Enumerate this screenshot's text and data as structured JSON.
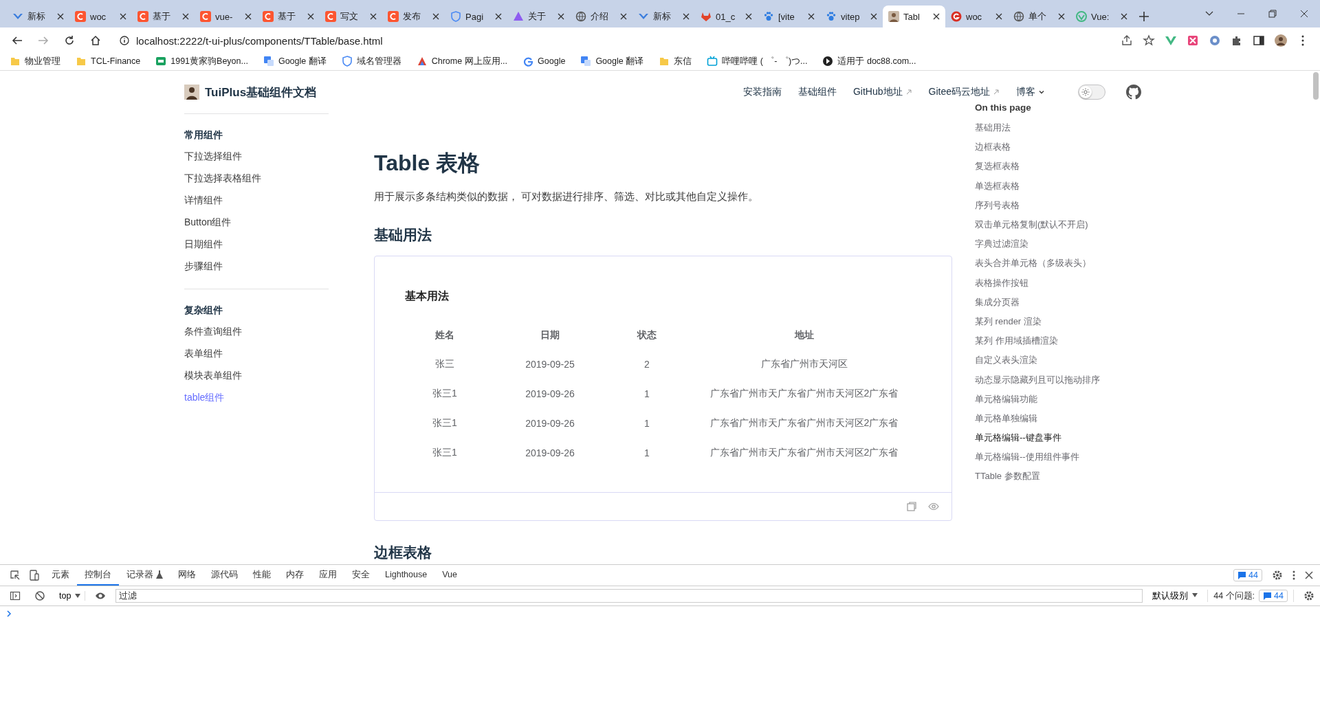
{
  "browser": {
    "tabs": [
      {
        "label": "新标",
        "kind": "bird",
        "selected": false
      },
      {
        "label": "woc",
        "kind": "csdn",
        "selected": false
      },
      {
        "label": "基于",
        "kind": "csdn",
        "selected": false
      },
      {
        "label": "vue-",
        "kind": "csdn",
        "selected": false
      },
      {
        "label": "基于",
        "kind": "csdn",
        "selected": false
      },
      {
        "label": "写文",
        "kind": "csdn",
        "selected": false
      },
      {
        "label": "发布",
        "kind": "csdn",
        "selected": false
      },
      {
        "label": "Pagi",
        "kind": "shield",
        "selected": false
      },
      {
        "label": "关于",
        "kind": "prism",
        "selected": false
      },
      {
        "label": "介绍",
        "kind": "globe",
        "selected": false
      },
      {
        "label": "新标",
        "kind": "bird",
        "selected": false
      },
      {
        "label": "01_c",
        "kind": "gitlab",
        "selected": false
      },
      {
        "label": "[vite",
        "kind": "paw",
        "selected": false
      },
      {
        "label": "vitep",
        "kind": "paw",
        "selected": false
      },
      {
        "label": "Tabl",
        "kind": "avatar",
        "selected": true
      },
      {
        "label": "woc",
        "kind": "google",
        "selected": false
      },
      {
        "label": "单个",
        "kind": "globe",
        "selected": false
      },
      {
        "label": "Vue:",
        "kind": "vue",
        "selected": false
      }
    ],
    "address": "localhost:2222/t-ui-plus/components/TTable/base.html",
    "bookmarks": [
      {
        "label": "物业管理",
        "kind": "folder"
      },
      {
        "label": "TCL-Finance",
        "kind": "folder"
      },
      {
        "label": "1991黄家驹Beyon...",
        "kind": "green"
      },
      {
        "label": "Google 翻译",
        "kind": "translate"
      },
      {
        "label": "域名管理器",
        "kind": "shield"
      },
      {
        "label": "Chrome 网上应用...",
        "kind": "store"
      },
      {
        "label": "Google",
        "kind": "google"
      },
      {
        "label": "Google 翻译",
        "kind": "translate"
      },
      {
        "label": "东信",
        "kind": "folder"
      },
      {
        "label": "哔哩哔哩 ( ゜- ゜)つ...",
        "kind": "tv"
      },
      {
        "label": "适用于 doc88.com...",
        "kind": "dark"
      }
    ]
  },
  "site": {
    "title": "TuiPlus基础组件文档",
    "nav": [
      {
        "label": "安装指南",
        "kind": "link"
      },
      {
        "label": "基础组件",
        "kind": "link"
      },
      {
        "label": "GitHub地址",
        "kind": "external"
      },
      {
        "label": "Gitee码云地址",
        "kind": "external"
      },
      {
        "label": "博客",
        "kind": "menu"
      }
    ],
    "dark_mode": false
  },
  "sidebar": [
    {
      "heading": "常用组件",
      "items": [
        {
          "label": "下拉选择组件",
          "selected": false
        },
        {
          "label": "下拉选择表格组件",
          "selected": false
        },
        {
          "label": "详情组件",
          "selected": false
        },
        {
          "label": "Button组件",
          "selected": false
        },
        {
          "label": "日期组件",
          "selected": false
        },
        {
          "label": "步骤组件",
          "selected": false
        }
      ]
    },
    {
      "heading": "复杂组件",
      "items": [
        {
          "label": "条件查询组件",
          "selected": false
        },
        {
          "label": "表单组件",
          "selected": false
        },
        {
          "label": "模块表单组件",
          "selected": false
        },
        {
          "label": "table组件",
          "selected": true
        }
      ]
    }
  ],
  "content": {
    "title": "Table 表格",
    "description": "用于展示多条结构类似的数据， 可对数据进行排序、筛选、对比或其他自定义操作。",
    "section": "基础用法",
    "demo": {
      "title": "基本用法",
      "columns": [
        "姓名",
        "日期",
        "状态",
        "地址"
      ],
      "rows": [
        [
          "张三",
          "2019-09-25",
          "2",
          "广东省广州市天河区"
        ],
        [
          "张三1",
          "2019-09-26",
          "1",
          "广东省广州市天广东省广州市天河区2广东省"
        ],
        [
          "张三1",
          "2019-09-26",
          "1",
          "广东省广州市天广东省广州市天河区2广东省"
        ],
        [
          "张三1",
          "2019-09-26",
          "1",
          "广东省广州市天广东省广州市天河区2广东省"
        ]
      ]
    },
    "next_section": "边框表格"
  },
  "toc": {
    "title": "On this page",
    "items": [
      {
        "label": "基础用法",
        "hovered": false
      },
      {
        "label": "边框表格",
        "hovered": false
      },
      {
        "label": "复选框表格",
        "hovered": false
      },
      {
        "label": "单选框表格",
        "hovered": false
      },
      {
        "label": "序列号表格",
        "hovered": false
      },
      {
        "label": "双击单元格复制(默认不开启)",
        "hovered": false
      },
      {
        "label": "字典过滤渲染",
        "hovered": false
      },
      {
        "label": "表头合并单元格（多级表头）",
        "hovered": false
      },
      {
        "label": "表格操作按钮",
        "hovered": false
      },
      {
        "label": "集成分页器",
        "hovered": false
      },
      {
        "label": "某列 render 渲染",
        "hovered": false
      },
      {
        "label": "某列 作用域插槽渲染",
        "hovered": false
      },
      {
        "label": "自定义表头渲染",
        "hovered": false
      },
      {
        "label": "动态显示隐藏列且可以拖动排序",
        "hovered": false
      },
      {
        "label": "单元格编辑功能",
        "hovered": false
      },
      {
        "label": "单元格单独编辑",
        "hovered": false
      },
      {
        "label": "单元格编辑--键盘事件",
        "hovered": true
      },
      {
        "label": "单元格编辑--使用组件事件",
        "hovered": false
      },
      {
        "label": "TTable 参数配置",
        "hovered": false
      }
    ]
  },
  "devtools": {
    "tabs": [
      {
        "label": "元素",
        "selected": false
      },
      {
        "label": "控制台",
        "selected": true
      },
      {
        "label": "记录器",
        "selected": false
      },
      {
        "label": "网络",
        "selected": false
      },
      {
        "label": "源代码",
        "selected": false
      },
      {
        "label": "性能",
        "selected": false
      },
      {
        "label": "内存",
        "selected": false
      },
      {
        "label": "应用",
        "selected": false
      },
      {
        "label": "安全",
        "selected": false
      },
      {
        "label": "Lighthouse",
        "selected": false
      },
      {
        "label": "Vue",
        "selected": false
      }
    ],
    "message_count": "44",
    "context": "top",
    "filter_placeholder": "过滤",
    "level": "默认级别",
    "issues_label": "44 个问题:",
    "issues_count": "44"
  }
}
